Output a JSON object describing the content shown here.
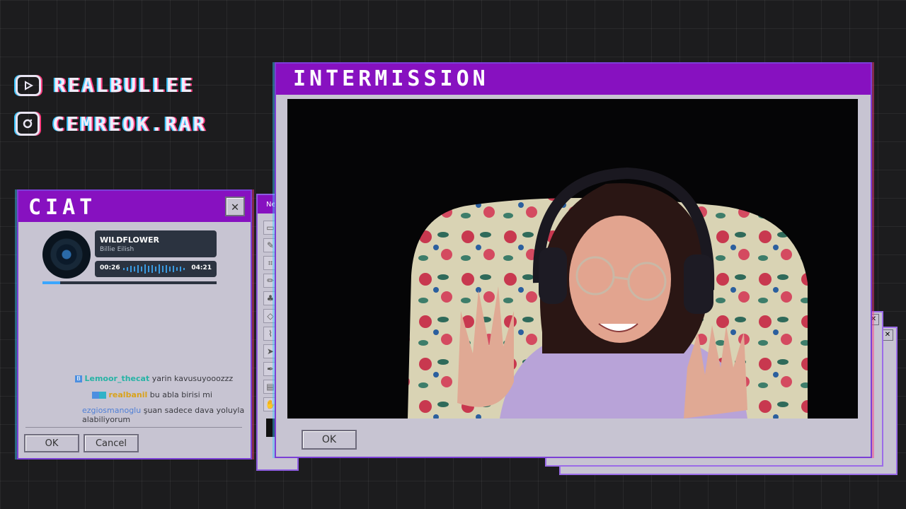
{
  "socials": [
    {
      "icon": "youtube-icon",
      "handle": "REALBULLEE"
    },
    {
      "icon": "instagram-icon",
      "handle": "CEMREOK.RAR"
    }
  ],
  "chat_window": {
    "title": "CIAT",
    "close_glyph": "✕",
    "ok_label": "OK",
    "cancel_label": "Cancel",
    "messages": [
      {
        "user": "Lemoor_thecat",
        "text": "yarin kavusuyooozzz",
        "user_color": "#27b3a5"
      },
      {
        "user": "realbanil",
        "text": "bu abla birisi mi",
        "user_color": "#d9a21b"
      },
      {
        "user": "ezgiosmanoglu",
        "text": "şuan sadece dava yoluyla alabiliyorum",
        "user_color": "#4f7fd6"
      }
    ]
  },
  "music_player": {
    "song_title": "WILDFLOWER",
    "artist": "Billie Eilish",
    "elapsed": "00:26",
    "duration": "04:21",
    "progress": 0.1
  },
  "toolbox": {
    "title": "Ne"
  },
  "main_window": {
    "title": "INTERMISSION",
    "ok_label": "OK"
  },
  "colors": {
    "accent": "#8711c0",
    "window_body": "#c7c4d2",
    "background": "#1c1c1e"
  }
}
